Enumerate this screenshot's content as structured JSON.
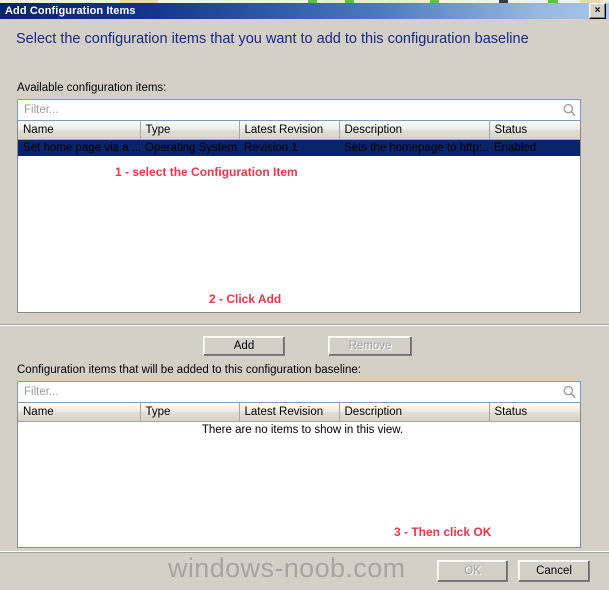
{
  "window": {
    "title": "Add Configuration Items",
    "close_label": "×"
  },
  "heading": "Select the configuration items that you want to add to this configuration baseline",
  "available": {
    "label": "Available configuration items:",
    "filter_placeholder": "Filter...",
    "search_icon": "magnifier-icon",
    "columns": [
      "Name",
      "Type",
      "Latest Revision",
      "Description",
      "Status"
    ],
    "rows": [
      {
        "name": "Set home page via a ...",
        "type": "Operating System",
        "latest_revision": "Revision 1",
        "description": "Sets the homepage to http:...",
        "status": "Enabled",
        "selected": true
      }
    ]
  },
  "middle_buttons": {
    "add_label": "Add",
    "remove_label": "Remove",
    "remove_disabled": true
  },
  "selected_section": {
    "label": "Configuration items that will be added to this configuration baseline:",
    "filter_placeholder": "Filter...",
    "search_icon": "magnifier-icon",
    "columns": [
      "Name",
      "Type",
      "Latest Revision",
      "Description",
      "Status"
    ],
    "empty_message": "There are no items to show in this view."
  },
  "footer": {
    "ok_label": "OK",
    "ok_disabled": true,
    "cancel_label": "Cancel"
  },
  "watermark": "windows-noob.com",
  "annotations": {
    "step1": "1 - select the Configuration Item",
    "step2": "2 - Click Add",
    "step3": "3 - Then click OK"
  },
  "colors": {
    "title_bar_start": "#0a246a",
    "title_bar_end": "#a8c6e8",
    "heading_text": "#17268f",
    "annotation": "#e8364a",
    "selection": "#0a246a",
    "dialog_face": "#d4d0c8",
    "watermark": "#a8a59f"
  }
}
